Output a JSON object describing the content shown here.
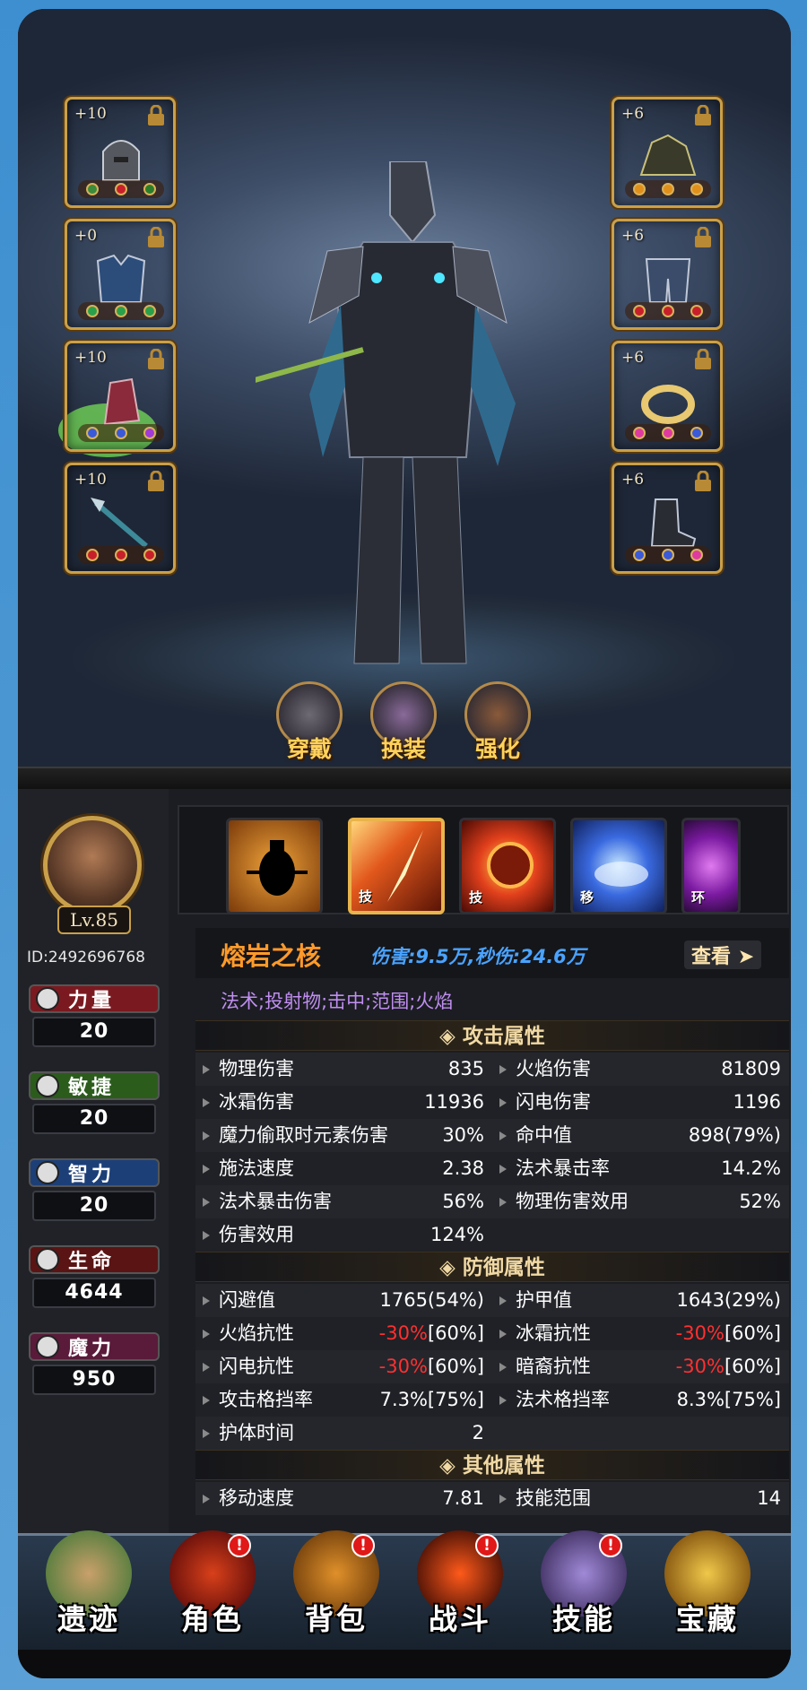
{
  "equipment": {
    "left": [
      {
        "plus": "+10",
        "frame": "purple"
      },
      {
        "plus": "+0",
        "frame": "orange"
      },
      {
        "plus": "+10",
        "frame": "orange"
      },
      {
        "plus": "+10",
        "frame": "orange"
      }
    ],
    "right": [
      {
        "plus": "+6",
        "frame": "orange"
      },
      {
        "plus": "+6",
        "frame": "orange"
      },
      {
        "plus": "+6",
        "frame": "orange"
      },
      {
        "plus": "+6",
        "frame": "orange"
      }
    ]
  },
  "actions": {
    "wear": "穿戴",
    "swap": "换装",
    "enhance": "强化"
  },
  "character": {
    "level": "Lv.85",
    "id": "ID:2492696768",
    "stats": [
      {
        "name": "力量",
        "value": "20",
        "color": "#8a1c22"
      },
      {
        "name": "敏捷",
        "value": "20",
        "color": "#2f6b1f"
      },
      {
        "name": "智力",
        "value": "20",
        "color": "#1f4a8a"
      },
      {
        "name": "生命",
        "value": "4644",
        "color": "#7a1a1a"
      },
      {
        "name": "魔力",
        "value": "950",
        "color": "#6a1a44"
      }
    ]
  },
  "skills": [
    {
      "tag": "",
      "selected": false
    },
    {
      "tag": "技",
      "selected": true
    },
    {
      "tag": "技",
      "selected": false
    },
    {
      "tag": "移",
      "selected": false
    },
    {
      "tag": "环",
      "selected": false
    }
  ],
  "skill_detail": {
    "name": "熔岩之核",
    "damage": "伤害:9.5万,秒伤:24.6万",
    "view_label": "查看",
    "tags": "法术;投射物;击中;范围;火焰"
  },
  "sections": {
    "attack": {
      "title": "攻击属性",
      "rows": [
        [
          {
            "k": "物理伤害",
            "v": "835"
          },
          {
            "k": "火焰伤害",
            "v": "81809"
          }
        ],
        [
          {
            "k": "冰霜伤害",
            "v": "11936"
          },
          {
            "k": "闪电伤害",
            "v": "1196"
          }
        ],
        [
          {
            "k": "魔力偷取时元素伤害",
            "v": "30%"
          },
          {
            "k": "命中值",
            "v": "898(79%)"
          }
        ],
        [
          {
            "k": "施法速度",
            "v": "2.38"
          },
          {
            "k": "法术暴击率",
            "v": "14.2%"
          }
        ],
        [
          {
            "k": "法术暴击伤害",
            "v": "56%"
          },
          {
            "k": "物理伤害效用",
            "v": "52%"
          }
        ],
        [
          {
            "k": "伤害效用",
            "v": "124%"
          }
        ]
      ]
    },
    "defense": {
      "title": "防御属性",
      "rows": [
        [
          {
            "k": "闪避值",
            "v": "1765(54%)"
          },
          {
            "k": "护甲值",
            "v": "1643(29%)"
          }
        ],
        [
          {
            "k": "火焰抗性",
            "red": "-30%",
            "v": "[60%]"
          },
          {
            "k": "冰霜抗性",
            "red": "-30%",
            "v": "[60%]"
          }
        ],
        [
          {
            "k": "闪电抗性",
            "red": "-30%",
            "v": "[60%]"
          },
          {
            "k": "暗裔抗性",
            "red": "-30%",
            "v": "[60%]"
          }
        ],
        [
          {
            "k": "攻击格挡率",
            "v": "7.3%[75%]"
          },
          {
            "k": "法术格挡率",
            "v": "8.3%[75%]"
          }
        ],
        [
          {
            "k": "护体时间",
            "v": "2"
          }
        ]
      ]
    },
    "other": {
      "title": "其他属性",
      "rows": [
        [
          {
            "k": "移动速度",
            "v": "7.81"
          },
          {
            "k": "技能范围",
            "v": "14"
          }
        ]
      ]
    }
  },
  "nav": [
    {
      "label": "遗迹",
      "badge": ""
    },
    {
      "label": "角色",
      "badge": "!"
    },
    {
      "label": "背包",
      "badge": "!"
    },
    {
      "label": "战斗",
      "badge": "!"
    },
    {
      "label": "技能",
      "badge": "!"
    },
    {
      "label": "宝藏",
      "badge": ""
    }
  ]
}
